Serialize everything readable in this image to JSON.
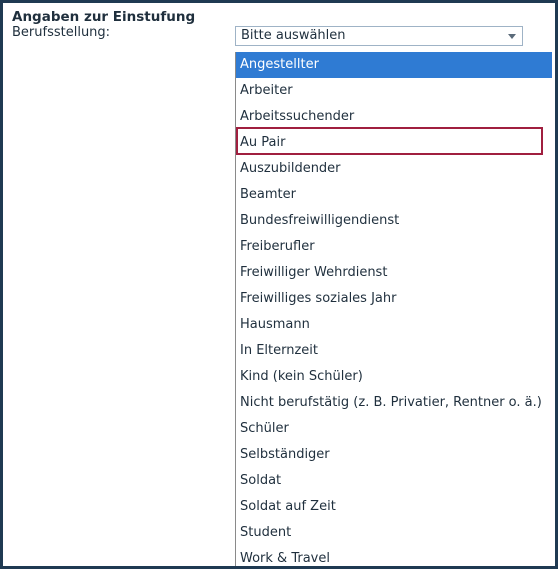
{
  "section": {
    "title": "Angaben zur Einstufung"
  },
  "field": {
    "label": "Berufsstellung:"
  },
  "select": {
    "value": "Bitte auswählen",
    "arrow_icon": "chevron-down-icon"
  },
  "dropdown": {
    "options": [
      "Angestellter",
      "Arbeiter",
      "Arbeitssuchender",
      "Au Pair",
      "Auszubildender",
      "Beamter",
      "Bundesfreiwilligendienst",
      "Freiberufler",
      "Freiwilliger Wehrdienst",
      "Freiwilliges soziales Jahr",
      "Hausmann",
      "In Elternzeit",
      "Kind (kein Schüler)",
      "Nicht berufstätig (z. B. Privatier, Rentner o. ä.)",
      "Schüler",
      "Selbständiger",
      "Soldat",
      "Soldat auf Zeit",
      "Student",
      "Work & Travel"
    ],
    "selected_option": "Angestellter",
    "highlighted_option": "Au Pair"
  },
  "colors": {
    "frame_border": "#1f3a52",
    "selected_bg": "#2f7bd3",
    "highlight_border": "#a01f3f"
  }
}
